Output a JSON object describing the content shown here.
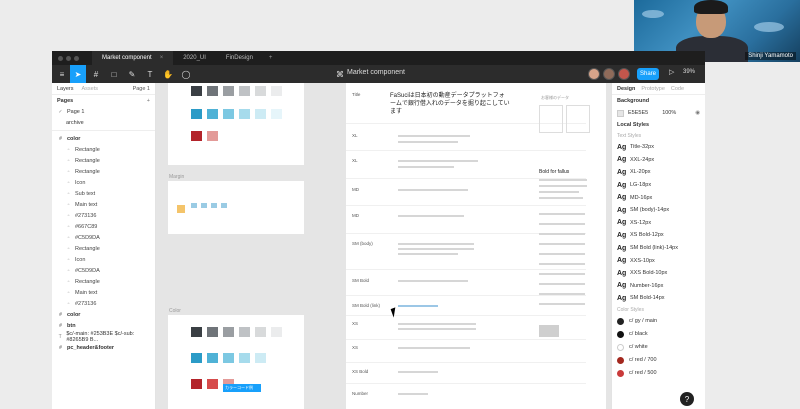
{
  "webcam": {
    "name": "Shinji Yamamoto"
  },
  "tabs": [
    {
      "label": "Market component",
      "close": "×"
    },
    {
      "label": "2020_UI"
    },
    {
      "label": "FinDesign"
    }
  ],
  "tab_add": "+",
  "toolbar": {
    "doc_title": "Market component",
    "share": "Share",
    "play": "▷",
    "zoom": "39%"
  },
  "left_panel": {
    "tab_layers": "Layers",
    "tab_assets": "Assets",
    "page_select": "Page 1",
    "pages_heading": "Pages",
    "add": "+",
    "pages": [
      "Page 1",
      "archive"
    ],
    "layers_root": "color",
    "layers": [
      "Rectangle",
      "Rectangle",
      "Rectangle",
      "Icon",
      "Sub text",
      "Main text",
      "#273136",
      "#667C89",
      "#C5D9DA",
      "Rectangle",
      "Icon",
      "#C5D9DA",
      "Rectangle",
      "Main text",
      "#273136"
    ],
    "bottom_layers": [
      "color",
      "btn",
      "$c/-main: #253B3E $c/-sub: #8265B9 B...",
      "pc_header&footer"
    ]
  },
  "canvas": {
    "frame_label_mid": "Margin",
    "frame_label_bottom": "Color",
    "tooltip": "カラーコード例",
    "doc_heading": "FaSuciは日本初の動産データプラットフォームで銀行借入れのデータを掘り起こしています",
    "doc_labels": [
      "Title",
      "XL",
      "XL",
      "MD",
      "MD",
      "SM (body)",
      "SM Bold",
      "SM Bold (link)",
      "XS",
      "XS",
      "XS Bold",
      "XS Bold",
      "Number",
      "Number"
    ],
    "side_heading": "Bold for fallus",
    "side_sub": "お客様のデータ"
  },
  "right_panel": {
    "tab_design": "Design",
    "tab_prototype": "Prototype",
    "tab_code": "Code",
    "background_heading": "Background",
    "bg_hex": "E5E5E5",
    "bg_pct": "100%",
    "local_styles_heading": "Local Styles",
    "text_styles_heading": "Text Styles",
    "ag": "Ag",
    "text_styles": [
      "Title-32px",
      "XXL-24px",
      "XL-20px",
      "LG-18px",
      "MD-16px",
      "SM (body)-14px",
      "XS-12px",
      "XS Bold-12px",
      "SM Bold (link)-14px",
      "XXS-10px",
      "XXS Bold-10px",
      "Number-16px",
      "SM Bold-14px"
    ],
    "color_styles_heading": "Color Styles",
    "color_styles": [
      {
        "name": "c/ gy / main",
        "color": "#222222"
      },
      {
        "name": "c/ black",
        "color": "#111111"
      },
      {
        "name": "c/ white",
        "color": "#ffffff"
      },
      {
        "name": "c/ red / 700",
        "color": "#a3281e"
      },
      {
        "name": "c/ red / 500",
        "color": "#c93a3a"
      }
    ]
  },
  "help": "?"
}
